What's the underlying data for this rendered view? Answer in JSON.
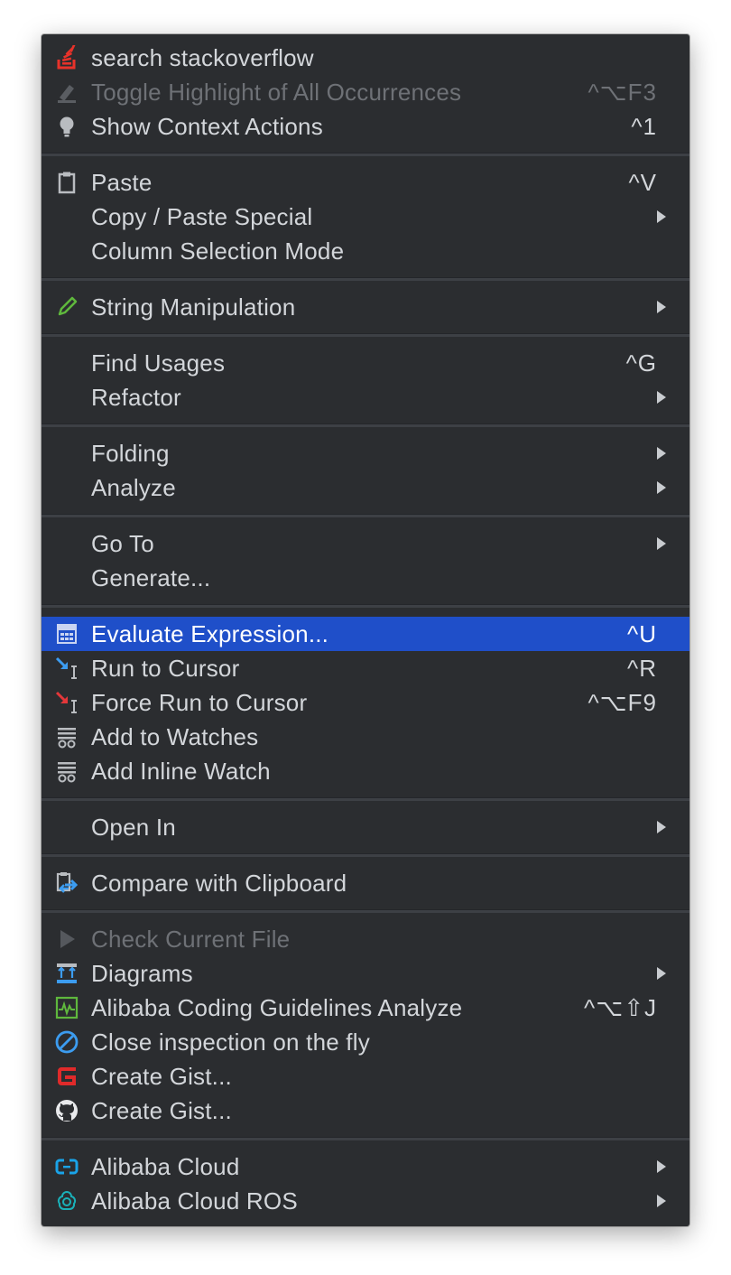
{
  "context_menu": {
    "items": [
      {
        "label": "search stackoverflow",
        "shortcut": "",
        "icon": "stackoverflow-icon"
      },
      {
        "label": "Toggle Highlight of All Occurrences",
        "shortcut": "^⌥F3",
        "icon": "highlighter-icon",
        "disabled": true
      },
      {
        "label": "Show Context Actions",
        "shortcut": "^1",
        "icon": "lightbulb-icon"
      },
      {
        "label": "Paste",
        "shortcut": "^V",
        "icon": "clipboard-icon"
      },
      {
        "label": "Copy / Paste Special",
        "shortcut": "",
        "submenu": true
      },
      {
        "label": "Column Selection Mode",
        "shortcut": ""
      },
      {
        "label": "String Manipulation",
        "shortcut": "",
        "icon": "pencil-icon",
        "submenu": true
      },
      {
        "label": "Find Usages",
        "shortcut": "^G"
      },
      {
        "label": "Refactor",
        "shortcut": "",
        "submenu": true
      },
      {
        "label": "Folding",
        "shortcut": "",
        "submenu": true
      },
      {
        "label": "Analyze",
        "shortcut": "",
        "submenu": true
      },
      {
        "label": "Go To",
        "shortcut": "",
        "submenu": true
      },
      {
        "label": "Generate...",
        "shortcut": ""
      },
      {
        "label": "Evaluate Expression...",
        "shortcut": "^U",
        "icon": "calculator-icon",
        "selected": true
      },
      {
        "label": "Run to Cursor",
        "shortcut": "^R",
        "icon": "run-to-cursor-icon"
      },
      {
        "label": "Force Run to Cursor",
        "shortcut": "^⌥F9",
        "icon": "force-run-to-cursor-icon"
      },
      {
        "label": "Add to Watches",
        "shortcut": "",
        "icon": "watches-icon"
      },
      {
        "label": "Add Inline Watch",
        "shortcut": "",
        "icon": "inline-watch-icon"
      },
      {
        "label": "Open In",
        "shortcut": "",
        "submenu": true
      },
      {
        "label": "Compare with Clipboard",
        "shortcut": "",
        "icon": "compare-clipboard-icon"
      },
      {
        "label": "Check Current File",
        "shortcut": "",
        "icon": "play-icon",
        "disabled": true
      },
      {
        "label": "Diagrams",
        "shortcut": "",
        "icon": "diagram-icon",
        "submenu": true
      },
      {
        "label": "Alibaba Coding Guidelines Analyze",
        "shortcut": "^⌥⇧J",
        "icon": "analyze-chart-icon"
      },
      {
        "label": "Close inspection on the fly",
        "shortcut": "",
        "icon": "prohibited-icon"
      },
      {
        "label": "Create Gist...",
        "shortcut": "",
        "icon": "gitee-icon"
      },
      {
        "label": "Create Gist...",
        "shortcut": "",
        "icon": "github-icon"
      },
      {
        "label": "Alibaba Cloud",
        "shortcut": "",
        "icon": "alibaba-cloud-icon",
        "submenu": true
      },
      {
        "label": "Alibaba Cloud ROS",
        "shortcut": "",
        "icon": "alibaba-cloud-ros-icon",
        "submenu": true
      }
    ]
  },
  "colors": {
    "menu_background": "#2b2d30",
    "selection": "#1f4fc9",
    "text": "#d3d6da",
    "disabled_text": "#6e7176"
  }
}
